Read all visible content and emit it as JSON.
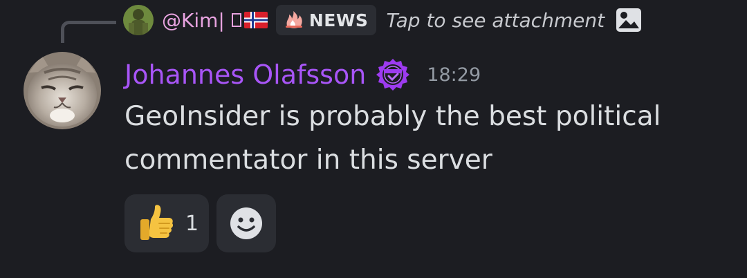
{
  "reply": {
    "username": "@Kim|",
    "tag_label": "NEWS",
    "content": "Tap to see attachment"
  },
  "message": {
    "author": "Johannes Olafsson",
    "author_color": "#a855f7",
    "timestamp": "18:29",
    "text": "GeoInsider is probably the best political\ncommentator in this server"
  },
  "reactions": [
    {
      "emoji": "thumbs-up",
      "count": "1"
    }
  ],
  "icons": {
    "badge": "trusted-badge-icon",
    "attachment": "image-icon",
    "add_reaction": "smile-icon"
  }
}
